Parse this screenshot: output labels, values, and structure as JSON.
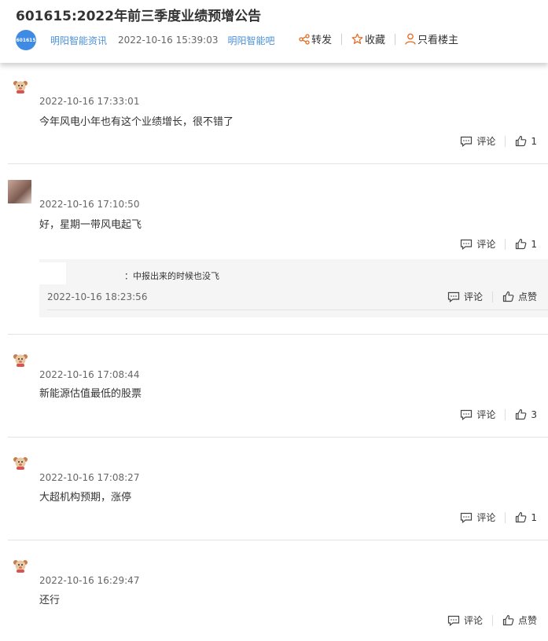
{
  "post": {
    "title": "601615:2022年前三季度业绩预增公告",
    "avatar_text": "601615",
    "author": "明阳智能资讯",
    "datetime": "2022-10-16 15:39:03",
    "forum": "明阳智能吧",
    "actions": {
      "share": "转发",
      "favorite": "收藏",
      "only_op": "只看楼主"
    }
  },
  "comments": [
    {
      "time": "2022-10-16 17:33:01",
      "text": "今年风电小年也有这个业绩增长，很不错了",
      "comment_label": "评论",
      "likes": "1"
    },
    {
      "time": "2022-10-16 17:10:50",
      "text": "好，星期一带风电起飞",
      "comment_label": "评论",
      "likes": "1",
      "reply": {
        "text": "：中报出来的时候也没飞",
        "time": "2022-10-16 18:23:56",
        "comment_label": "评论",
        "like_label": "点赞"
      }
    },
    {
      "time": "2022-10-16 17:08:44",
      "text": "新能源估值最低的股票",
      "comment_label": "评论",
      "likes": "3"
    },
    {
      "time": "2022-10-16 17:08:27",
      "text": "大超机构预期，涨停",
      "comment_label": "评论",
      "likes": "1"
    },
    {
      "time": "2022-10-16 16:29:47",
      "text": "还行",
      "comment_label": "评论",
      "likes": "点赞"
    }
  ]
}
